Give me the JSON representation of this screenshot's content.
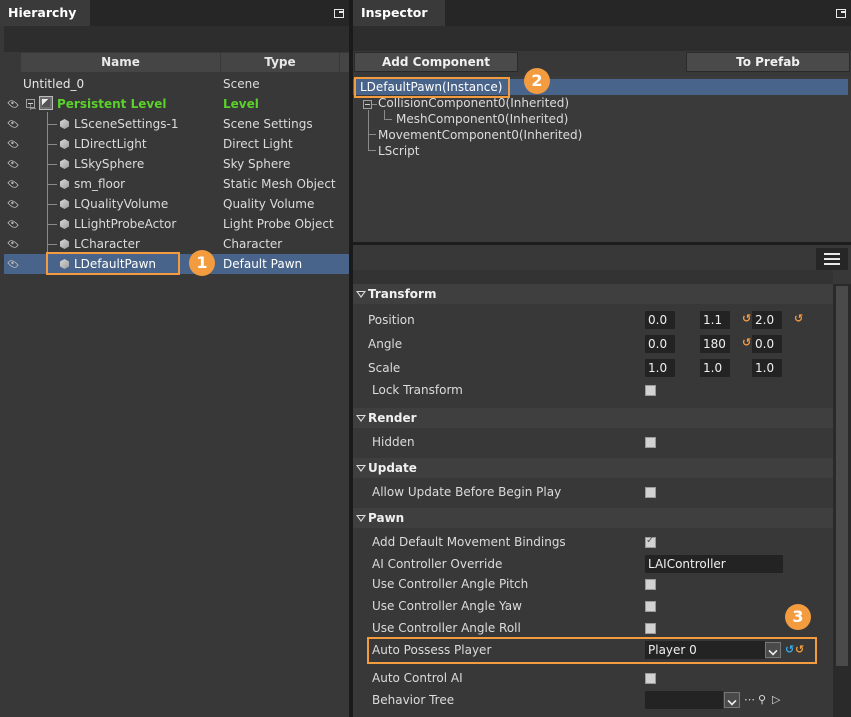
{
  "hierarchy": {
    "title": "Hierarchy",
    "col_name": "Name",
    "col_type": "Type",
    "rows": [
      {
        "name": "Untitled_0",
        "type": "Scene"
      },
      {
        "name": "Persistent Level",
        "type": "Level"
      },
      {
        "name": "LSceneSettings-1",
        "type": "Scene Settings"
      },
      {
        "name": "LDirectLight",
        "type": "Direct Light"
      },
      {
        "name": "LSkySphere",
        "type": "Sky Sphere"
      },
      {
        "name": "sm_floor",
        "type": "Static Mesh Object"
      },
      {
        "name": "LQualityVolume",
        "type": "Quality Volume"
      },
      {
        "name": "LLightProbeActor",
        "type": "Light Probe Object"
      },
      {
        "name": "LCharacter",
        "type": "Character"
      },
      {
        "name": "LDefaultPawn",
        "type": "Default Pawn"
      }
    ]
  },
  "inspector": {
    "title": "Inspector",
    "add_component": "Add Component",
    "to_prefab": "To Prefab",
    "components": [
      "LDefaultPawn(Instance)",
      "CollisionComponent0(Inherited)",
      "MeshComponent0(Inherited)",
      "MovementComponent0(Inherited)",
      "LScript"
    ],
    "transform": {
      "header": "Transform",
      "position_label": "Position",
      "position": [
        "0.0",
        "1.1",
        "2.0"
      ],
      "angle_label": "Angle",
      "angle": [
        "0.0",
        "180",
        "0.0"
      ],
      "scale_label": "Scale",
      "scale": [
        "1.0",
        "1.0",
        "1.0"
      ],
      "lock_label": "Lock Transform"
    },
    "render": {
      "header": "Render",
      "hidden_label": "Hidden"
    },
    "update": {
      "header": "Update",
      "allow_label": "Allow Update Before Begin Play"
    },
    "pawn": {
      "header": "Pawn",
      "add_bindings_label": "Add Default Movement Bindings",
      "ai_override_label": "AI Controller Override",
      "ai_override_value": "LAIController",
      "pitch_label": "Use Controller Angle Pitch",
      "yaw_label": "Use Controller Angle Yaw",
      "roll_label": "Use Controller Angle Roll",
      "auto_possess_label": "Auto Possess Player",
      "auto_possess_value": "Player 0",
      "auto_ai_label": "Auto Control AI",
      "behavior_label": "Behavior Tree",
      "behavior_value": ""
    }
  },
  "callouts": [
    "1",
    "2",
    "3"
  ],
  "colors": {
    "accent_orange": "#f29b3f",
    "selection_blue": "#49648a",
    "level_green": "#5ad22a",
    "reset_blue": "#38a8e8"
  }
}
